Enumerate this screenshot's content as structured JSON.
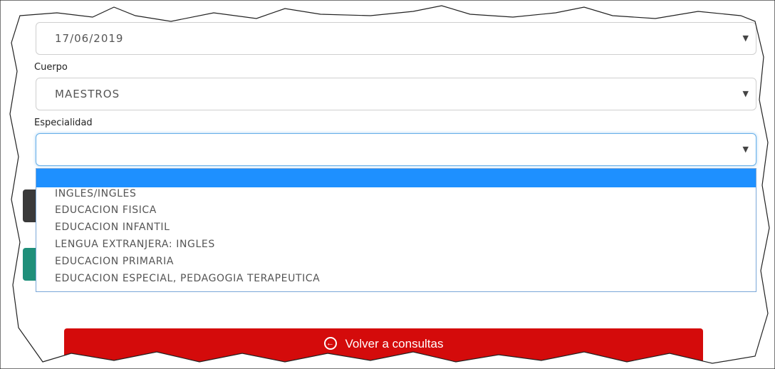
{
  "fecha": {
    "value": "17/06/2019"
  },
  "cuerpo": {
    "label": "Cuerpo",
    "value": "MAESTROS"
  },
  "especialidad": {
    "label": "Especialidad",
    "value": "",
    "options": [
      "",
      "INGLES/INGLES",
      "EDUCACION FISICA",
      "EDUCACION INFANTIL",
      "LENGUA EXTRANJERA: INGLES",
      "EDUCACION PRIMARIA",
      "EDUCACION ESPECIAL, PEDAGOGIA TERAPEUTICA"
    ]
  },
  "back_button": {
    "label": "Volver a consultas",
    "icon": "circle-arrow-left-icon"
  },
  "colors": {
    "highlight": "#1e90ff",
    "back_button": "#d40b0b",
    "focus_border": "#66afe9"
  }
}
